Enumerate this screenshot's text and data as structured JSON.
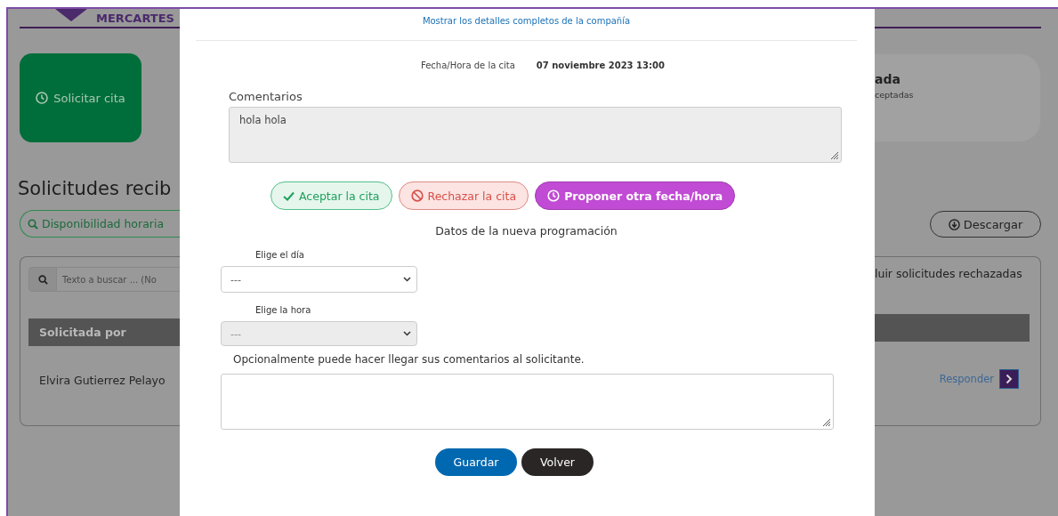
{
  "background": {
    "logo": "MERCARTES",
    "request_card": {
      "label": "Solicitar cita"
    },
    "summary_card": {
      "title": "ada",
      "subtitle": "ceptadas"
    },
    "heading": "Solicitudes recib",
    "availability_button": "Disponibilidad horaria",
    "download_button": "Descargar",
    "search": {
      "placeholder": "Texto a buscar ... (No"
    },
    "filter_label": "luir solicitudes rechazadas",
    "table": {
      "columns": [
        "Solicitada por"
      ],
      "rows": [
        {
          "requested_by": "Elvira Gutierrez Pelayo",
          "action": "Responder"
        }
      ]
    }
  },
  "modal": {
    "company_link": "Mostrar los detalles completos de la compañía",
    "date_label": "Fecha/Hora de la cita",
    "date_value": "07 noviembre 2023 13:00",
    "comments_label": "Comentarios",
    "comments_value": "hola hola",
    "actions": [
      {
        "kind": "accept",
        "label": "Aceptar la cita",
        "selected": false
      },
      {
        "kind": "reject",
        "label": "Rechazar la cita",
        "selected": false
      },
      {
        "kind": "propose",
        "label": "Proponer otra fecha/hora",
        "selected": true
      }
    ],
    "section_title": "Datos de la nueva programación",
    "day": {
      "label": "Elige el día",
      "value": "---",
      "disabled": false
    },
    "hour": {
      "label": "Elige la hora",
      "value": "---",
      "disabled": true
    },
    "note_label": "Opcionalmente puede hacer llegar sus comentarios al solicitante.",
    "buttons": [
      {
        "kind": "primary",
        "label": "Guardar"
      },
      {
        "kind": "dark",
        "label": "Volver"
      }
    ]
  }
}
